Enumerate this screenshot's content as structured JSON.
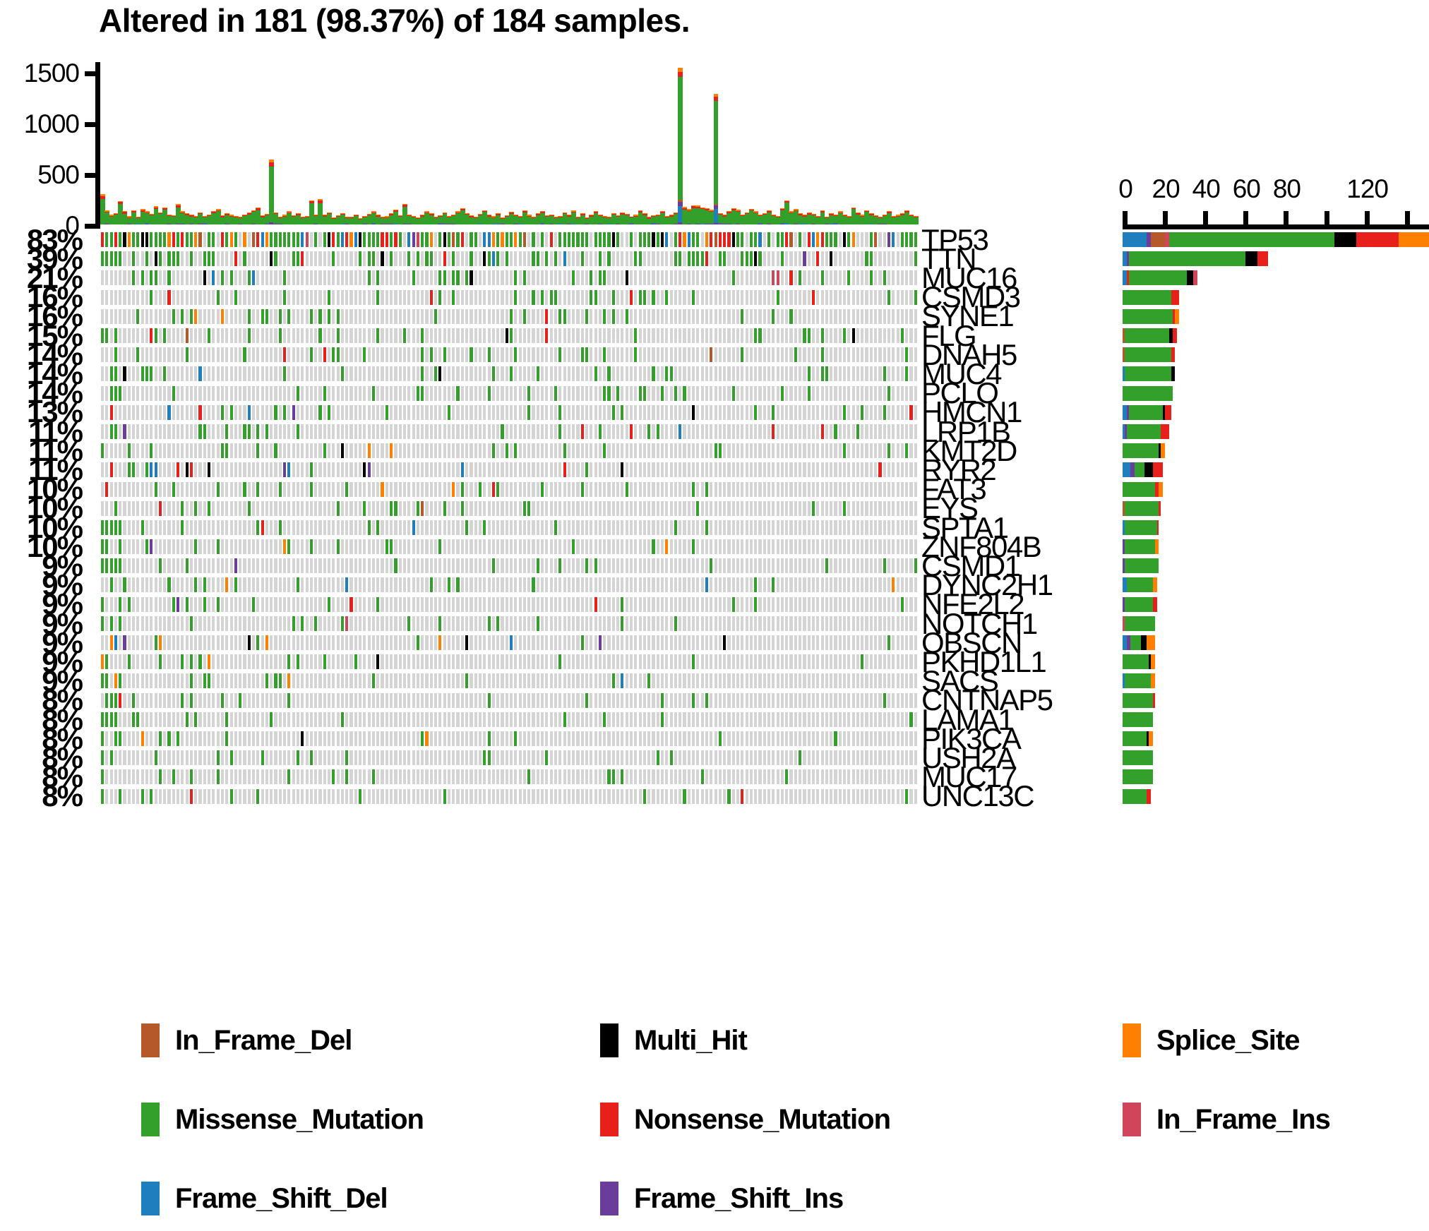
{
  "title": "Altered in 181 (98.37%) of 184 samples.",
  "colors": {
    "In_Frame_Del": "#B5592A",
    "Multi_Hit": "#000000",
    "Splice_Site": "#FF8000",
    "Missense_Mutation": "#34A02C",
    "Nonsense_Mutation": "#E8201C",
    "In_Frame_Ins": "#D1455B",
    "Frame_Shift_Del": "#1F7FBE",
    "Frame_Shift_Ins": "#6A3D9A",
    "background": "#D4D4D4",
    "axis": "#000000"
  },
  "legend": {
    "items": [
      {
        "label": "In_Frame_Del",
        "color_key": "In_Frame_Del",
        "col": 0,
        "row": 0
      },
      {
        "label": "Multi_Hit",
        "color_key": "Multi_Hit",
        "col": 1,
        "row": 0
      },
      {
        "label": "Splice_Site",
        "color_key": "Splice_Site",
        "col": 2,
        "row": 0
      },
      {
        "label": "Missense_Mutation",
        "color_key": "Missense_Mutation",
        "col": 0,
        "row": 1
      },
      {
        "label": "Nonsense_Mutation",
        "color_key": "Nonsense_Mutation",
        "col": 1,
        "row": 1
      },
      {
        "label": "In_Frame_Ins",
        "color_key": "In_Frame_Ins",
        "col": 2,
        "row": 1
      },
      {
        "label": "Frame_Shift_Del",
        "color_key": "Frame_Shift_Del",
        "col": 0,
        "row": 2
      },
      {
        "label": "Frame_Shift_Ins",
        "color_key": "Frame_Shift_Ins",
        "col": 1,
        "row": 2
      }
    ]
  },
  "chart_data": {
    "type": "oncoprint",
    "title": "Altered in 181 (98.37%) of 184 samples.",
    "n_samples": 184,
    "n_altered": 181,
    "altered_pct": 98.37,
    "top_barplot": {
      "type": "bar",
      "ylabel": "",
      "ylim": [
        0,
        1600
      ],
      "yticks": [
        0,
        500,
        1000,
        1500
      ],
      "ytick_labels": [
        "0",
        "500",
        "1000",
        "1500"
      ],
      "stacked": true,
      "description": "Per-sample total mutation burden (TMB), stacked by variant class",
      "totals": [
        300,
        140,
        95,
        110,
        230,
        130,
        80,
        140,
        75,
        150,
        130,
        105,
        180,
        120,
        170,
        100,
        90,
        200,
        130,
        110,
        95,
        85,
        120,
        80,
        100,
        130,
        150,
        90,
        110,
        95,
        85,
        75,
        100,
        120,
        140,
        170,
        90,
        105,
        640,
        120,
        80,
        95,
        130,
        90,
        110,
        75,
        85,
        240,
        100,
        250,
        95,
        120,
        70,
        90,
        110,
        80,
        75,
        100,
        60,
        85,
        105,
        130,
        95,
        75,
        80,
        110,
        145,
        90,
        200,
        100,
        85,
        70,
        95,
        130,
        110,
        75,
        90,
        120,
        85,
        100,
        130,
        160,
        110,
        90,
        75,
        105,
        140,
        95,
        80,
        110,
        70,
        90,
        125,
        100,
        85,
        140,
        95,
        75,
        110,
        130,
        90,
        100,
        75,
        85,
        120,
        95,
        140,
        80,
        110,
        70,
        95,
        130,
        100,
        85,
        75,
        110,
        90,
        120,
        105,
        80,
        95,
        140,
        110,
        75,
        90,
        100,
        130,
        85,
        95,
        120,
        1545,
        175,
        150,
        190,
        185,
        170,
        160,
        145,
        1290,
        110,
        95,
        130,
        160,
        145,
        100,
        120,
        155,
        130,
        95,
        110,
        140,
        100,
        85,
        160,
        240,
        130,
        150,
        110,
        95,
        120,
        105,
        85,
        140,
        75,
        110,
        95,
        130,
        100,
        85,
        170,
        120,
        95,
        140,
        110,
        90,
        75,
        100,
        130,
        85,
        95,
        110,
        140,
        100,
        85
      ]
    },
    "right_barplot": {
      "type": "bar",
      "orientation": "horizontal",
      "xlim": [
        0,
        152
      ],
      "xticks": [
        0,
        20,
        40,
        60,
        80,
        100,
        120,
        140
      ],
      "xtick_labels": [
        "0",
        "20",
        "40",
        "60",
        "80",
        "",
        "120",
        ""
      ],
      "description": "Number of mutated samples per gene, stacked by variant class"
    },
    "genes": [
      {
        "name": "TP53",
        "pct": "83%",
        "total": 152,
        "segments": [
          {
            "type": "Frame_Shift_Del",
            "value": 12
          },
          {
            "type": "Frame_Shift_Ins",
            "value": 2
          },
          {
            "type": "In_Frame_Del",
            "value": 7
          },
          {
            "type": "In_Frame_Ins",
            "value": 2
          },
          {
            "type": "Missense_Mutation",
            "value": 82
          },
          {
            "type": "Multi_Hit",
            "value": 11
          },
          {
            "type": "Nonsense_Mutation",
            "value": 21
          },
          {
            "type": "Splice_Site",
            "value": 15
          }
        ]
      },
      {
        "name": "TTN",
        "pct": "39%",
        "total": 72,
        "segments": [
          {
            "type": "Frame_Shift_Del",
            "value": 2
          },
          {
            "type": "Frame_Shift_Ins",
            "value": 1
          },
          {
            "type": "Missense_Mutation",
            "value": 58
          },
          {
            "type": "Multi_Hit",
            "value": 6
          },
          {
            "type": "Nonsense_Mutation",
            "value": 5
          }
        ]
      },
      {
        "name": "MUC16",
        "pct": "21%",
        "total": 37,
        "segments": [
          {
            "type": "Frame_Shift_Del",
            "value": 2
          },
          {
            "type": "Nonsense_Mutation",
            "value": 1
          },
          {
            "type": "Missense_Mutation",
            "value": 29
          },
          {
            "type": "Multi_Hit",
            "value": 3
          },
          {
            "type": "In_Frame_Ins",
            "value": 2
          }
        ]
      },
      {
        "name": "CSMD3",
        "pct": "16%",
        "total": 28,
        "segments": [
          {
            "type": "Missense_Mutation",
            "value": 24
          },
          {
            "type": "Nonsense_Mutation",
            "value": 4
          }
        ]
      },
      {
        "name": "SYNE1",
        "pct": "16%",
        "total": 28,
        "segments": [
          {
            "type": "Missense_Mutation",
            "value": 25
          },
          {
            "type": "Nonsense_Mutation",
            "value": 1
          },
          {
            "type": "Splice_Site",
            "value": 2
          }
        ]
      },
      {
        "name": "FLG",
        "pct": "15%",
        "total": 27,
        "segments": [
          {
            "type": "In_Frame_Del",
            "value": 1
          },
          {
            "type": "Missense_Mutation",
            "value": 22
          },
          {
            "type": "Multi_Hit",
            "value": 2
          },
          {
            "type": "Nonsense_Mutation",
            "value": 2
          }
        ]
      },
      {
        "name": "DNAH5",
        "pct": "14%",
        "total": 26,
        "segments": [
          {
            "type": "In_Frame_Del",
            "value": 1
          },
          {
            "type": "Missense_Mutation",
            "value": 23
          },
          {
            "type": "Nonsense_Mutation",
            "value": 2
          }
        ]
      },
      {
        "name": "MUC4",
        "pct": "14%",
        "total": 26,
        "segments": [
          {
            "type": "Frame_Shift_Del",
            "value": 1
          },
          {
            "type": "Missense_Mutation",
            "value": 23
          },
          {
            "type": "Multi_Hit",
            "value": 2
          }
        ]
      },
      {
        "name": "PCLO",
        "pct": "14%",
        "total": 25,
        "segments": [
          {
            "type": "Missense_Mutation",
            "value": 25
          }
        ]
      },
      {
        "name": "HMCN1",
        "pct": "13%",
        "total": 24,
        "segments": [
          {
            "type": "Frame_Shift_Del",
            "value": 2
          },
          {
            "type": "Frame_Shift_Ins",
            "value": 1
          },
          {
            "type": "Missense_Mutation",
            "value": 17
          },
          {
            "type": "Multi_Hit",
            "value": 1
          },
          {
            "type": "Nonsense_Mutation",
            "value": 3
          }
        ]
      },
      {
        "name": "LRP1B",
        "pct": "11%",
        "total": 23,
        "segments": [
          {
            "type": "Frame_Shift_Del",
            "value": 1
          },
          {
            "type": "Frame_Shift_Ins",
            "value": 1
          },
          {
            "type": "Missense_Mutation",
            "value": 17
          },
          {
            "type": "Nonsense_Mutation",
            "value": 4
          }
        ]
      },
      {
        "name": "KMT2D",
        "pct": "11%",
        "total": 21,
        "segments": [
          {
            "type": "Missense_Mutation",
            "value": 18
          },
          {
            "type": "Multi_Hit",
            "value": 1
          },
          {
            "type": "Splice_Site",
            "value": 2
          }
        ]
      },
      {
        "name": "RYR2",
        "pct": "11%",
        "total": 20,
        "segments": [
          {
            "type": "Frame_Shift_Del",
            "value": 4
          },
          {
            "type": "Frame_Shift_Ins",
            "value": 2
          },
          {
            "type": "Missense_Mutation",
            "value": 5
          },
          {
            "type": "Multi_Hit",
            "value": 4
          },
          {
            "type": "Nonsense_Mutation",
            "value": 5
          }
        ]
      },
      {
        "name": "FAT3",
        "pct": "10%",
        "total": 20,
        "segments": [
          {
            "type": "Missense_Mutation",
            "value": 16
          },
          {
            "type": "Nonsense_Mutation",
            "value": 2
          },
          {
            "type": "Splice_Site",
            "value": 2
          }
        ]
      },
      {
        "name": "EYS",
        "pct": "10%",
        "total": 19,
        "segments": [
          {
            "type": "In_Frame_Del",
            "value": 1
          },
          {
            "type": "Missense_Mutation",
            "value": 17
          },
          {
            "type": "Nonsense_Mutation",
            "value": 1
          }
        ]
      },
      {
        "name": "SPTA1",
        "pct": "10%",
        "total": 18,
        "segments": [
          {
            "type": "Frame_Shift_Del",
            "value": 1
          },
          {
            "type": "Missense_Mutation",
            "value": 16
          },
          {
            "type": "Nonsense_Mutation",
            "value": 1
          }
        ]
      },
      {
        "name": "ZNF804B",
        "pct": "10%",
        "total": 18,
        "segments": [
          {
            "type": "Frame_Shift_Ins",
            "value": 1
          },
          {
            "type": "Missense_Mutation",
            "value": 15
          },
          {
            "type": "Splice_Site",
            "value": 2
          }
        ]
      },
      {
        "name": "CSMD1",
        "pct": "9%",
        "total": 18,
        "segments": [
          {
            "type": "Frame_Shift_Ins",
            "value": 1
          },
          {
            "type": "Missense_Mutation",
            "value": 17
          }
        ]
      },
      {
        "name": "DYNC2H1",
        "pct": "9%",
        "total": 17,
        "segments": [
          {
            "type": "Frame_Shift_Del",
            "value": 2
          },
          {
            "type": "Missense_Mutation",
            "value": 13
          },
          {
            "type": "Splice_Site",
            "value": 2
          }
        ]
      },
      {
        "name": "NFE2L2",
        "pct": "9%",
        "total": 17,
        "segments": [
          {
            "type": "Frame_Shift_Ins",
            "value": 1
          },
          {
            "type": "Missense_Mutation",
            "value": 14
          },
          {
            "type": "Nonsense_Mutation",
            "value": 2
          }
        ]
      },
      {
        "name": "NOTCH1",
        "pct": "9%",
        "total": 16,
        "segments": [
          {
            "type": "In_Frame_Ins",
            "value": 1
          },
          {
            "type": "Missense_Mutation",
            "value": 15
          }
        ]
      },
      {
        "name": "OBSCN",
        "pct": "9%",
        "total": 16,
        "segments": [
          {
            "type": "Frame_Shift_Del",
            "value": 2
          },
          {
            "type": "Frame_Shift_Ins",
            "value": 2
          },
          {
            "type": "Missense_Mutation",
            "value": 5
          },
          {
            "type": "Multi_Hit",
            "value": 3
          },
          {
            "type": "Splice_Site",
            "value": 4
          }
        ]
      },
      {
        "name": "PKHD1L1",
        "pct": "9%",
        "total": 16,
        "segments": [
          {
            "type": "Missense_Mutation",
            "value": 13
          },
          {
            "type": "Multi_Hit",
            "value": 1
          },
          {
            "type": "Splice_Site",
            "value": 2
          }
        ]
      },
      {
        "name": "SACS",
        "pct": "9%",
        "total": 16,
        "segments": [
          {
            "type": "Frame_Shift_Del",
            "value": 1
          },
          {
            "type": "Missense_Mutation",
            "value": 13
          },
          {
            "type": "Splice_Site",
            "value": 2
          }
        ]
      },
      {
        "name": "CNTNAP5",
        "pct": "8%",
        "total": 16,
        "segments": [
          {
            "type": "Missense_Mutation",
            "value": 15
          },
          {
            "type": "Nonsense_Mutation",
            "value": 1
          }
        ]
      },
      {
        "name": "LAMA1",
        "pct": "8%",
        "total": 15,
        "segments": [
          {
            "type": "Missense_Mutation",
            "value": 15
          }
        ]
      },
      {
        "name": "PIK3CA",
        "pct": "8%",
        "total": 15,
        "segments": [
          {
            "type": "Missense_Mutation",
            "value": 12
          },
          {
            "type": "Multi_Hit",
            "value": 1
          },
          {
            "type": "Splice_Site",
            "value": 2
          }
        ]
      },
      {
        "name": "USH2A",
        "pct": "8%",
        "total": 15,
        "segments": [
          {
            "type": "Missense_Mutation",
            "value": 15
          }
        ]
      },
      {
        "name": "MUC17",
        "pct": "8%",
        "total": 15,
        "segments": [
          {
            "type": "Missense_Mutation",
            "value": 15
          }
        ]
      },
      {
        "name": "UNC13C",
        "pct": "8%",
        "total": 14,
        "segments": [
          {
            "type": "Missense_Mutation",
            "value": 12
          },
          {
            "type": "Nonsense_Mutation",
            "value": 2
          }
        ]
      }
    ]
  }
}
